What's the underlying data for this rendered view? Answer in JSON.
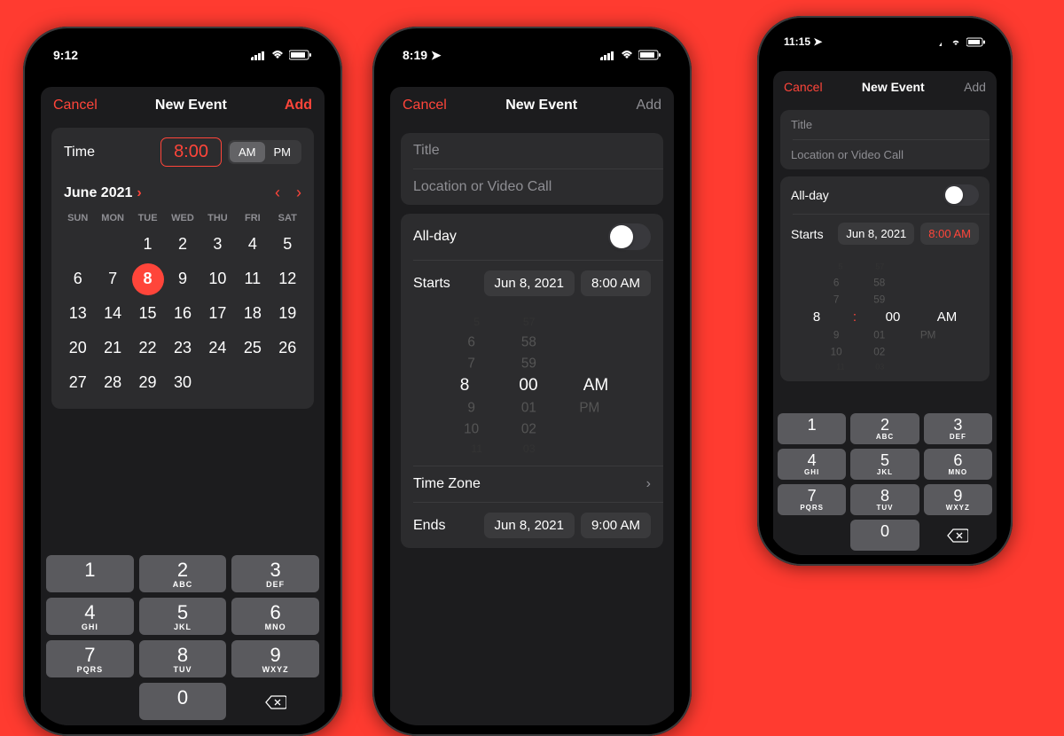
{
  "accent": "#ff453a",
  "dow": [
    "SUN",
    "MON",
    "TUE",
    "WED",
    "THU",
    "FRI",
    "SAT"
  ],
  "keypad": [
    {
      "n": "1",
      "l": ""
    },
    {
      "n": "2",
      "l": "ABC"
    },
    {
      "n": "3",
      "l": "DEF"
    },
    {
      "n": "4",
      "l": "GHI"
    },
    {
      "n": "5",
      "l": "JKL"
    },
    {
      "n": "6",
      "l": "MNO"
    },
    {
      "n": "7",
      "l": "PQRS"
    },
    {
      "n": "8",
      "l": "TUV"
    },
    {
      "n": "9",
      "l": "WXYZ"
    },
    {
      "n": "",
      "l": ""
    },
    {
      "n": "0",
      "l": ""
    },
    {
      "n": "del",
      "l": ""
    }
  ],
  "phone1": {
    "status_time": "9:12",
    "nav": {
      "cancel": "Cancel",
      "title": "New Event",
      "add": "Add"
    },
    "time_label": "Time",
    "time_value": "8:00",
    "am": "AM",
    "pm": "PM",
    "month": "June 2021",
    "selected_day": "8",
    "days_row1": [
      "",
      "1",
      "2",
      "3",
      "4",
      "5"
    ],
    "days_rows": [
      [
        "6",
        "7",
        "8",
        "9",
        "10",
        "11",
        "12"
      ],
      [
        "13",
        "14",
        "15",
        "16",
        "17",
        "18",
        "19"
      ],
      [
        "20",
        "21",
        "22",
        "23",
        "24",
        "25",
        "26"
      ],
      [
        "27",
        "28",
        "29",
        "30",
        "",
        "",
        ""
      ]
    ]
  },
  "phone2": {
    "status_time": "8:19",
    "nav": {
      "cancel": "Cancel",
      "title": "New Event",
      "add": "Add"
    },
    "title_placeholder": "Title",
    "location_placeholder": "Location or Video Call",
    "allday": "All-day",
    "starts": "Starts",
    "starts_date": "Jun 8, 2021",
    "starts_time": "8:00 AM",
    "picker": [
      {
        "h": "5",
        "m": "57",
        "p": ""
      },
      {
        "h": "6",
        "m": "58",
        "p": ""
      },
      {
        "h": "7",
        "m": "59",
        "p": ""
      },
      {
        "h": "8",
        "m": "00",
        "p": "AM"
      },
      {
        "h": "9",
        "m": "01",
        "p": "PM"
      },
      {
        "h": "10",
        "m": "02",
        "p": ""
      },
      {
        "h": "11",
        "m": "03",
        "p": ""
      }
    ],
    "timezone": "Time Zone",
    "ends": "Ends",
    "ends_date": "Jun 8, 2021",
    "ends_time": "9:00 AM"
  },
  "phone3": {
    "status_time": "11:15",
    "nav": {
      "cancel": "Cancel",
      "title": "New Event",
      "add": "Add"
    },
    "title_placeholder": "Title",
    "location_placeholder": "Location or Video Call",
    "allday": "All-day",
    "starts": "Starts",
    "starts_date": "Jun 8, 2021",
    "starts_time": "8:00 AM",
    "picker": [
      {
        "h": "5",
        "m": "57",
        "p": ""
      },
      {
        "h": "6",
        "m": "58",
        "p": ""
      },
      {
        "h": "7",
        "m": "59",
        "p": ""
      },
      {
        "h": "8",
        "m": "00",
        "p": "AM"
      },
      {
        "h": "9",
        "m": "01",
        "p": "PM"
      },
      {
        "h": "10",
        "m": "02",
        "p": ""
      },
      {
        "h": "11",
        "m": "03",
        "p": ""
      }
    ]
  }
}
